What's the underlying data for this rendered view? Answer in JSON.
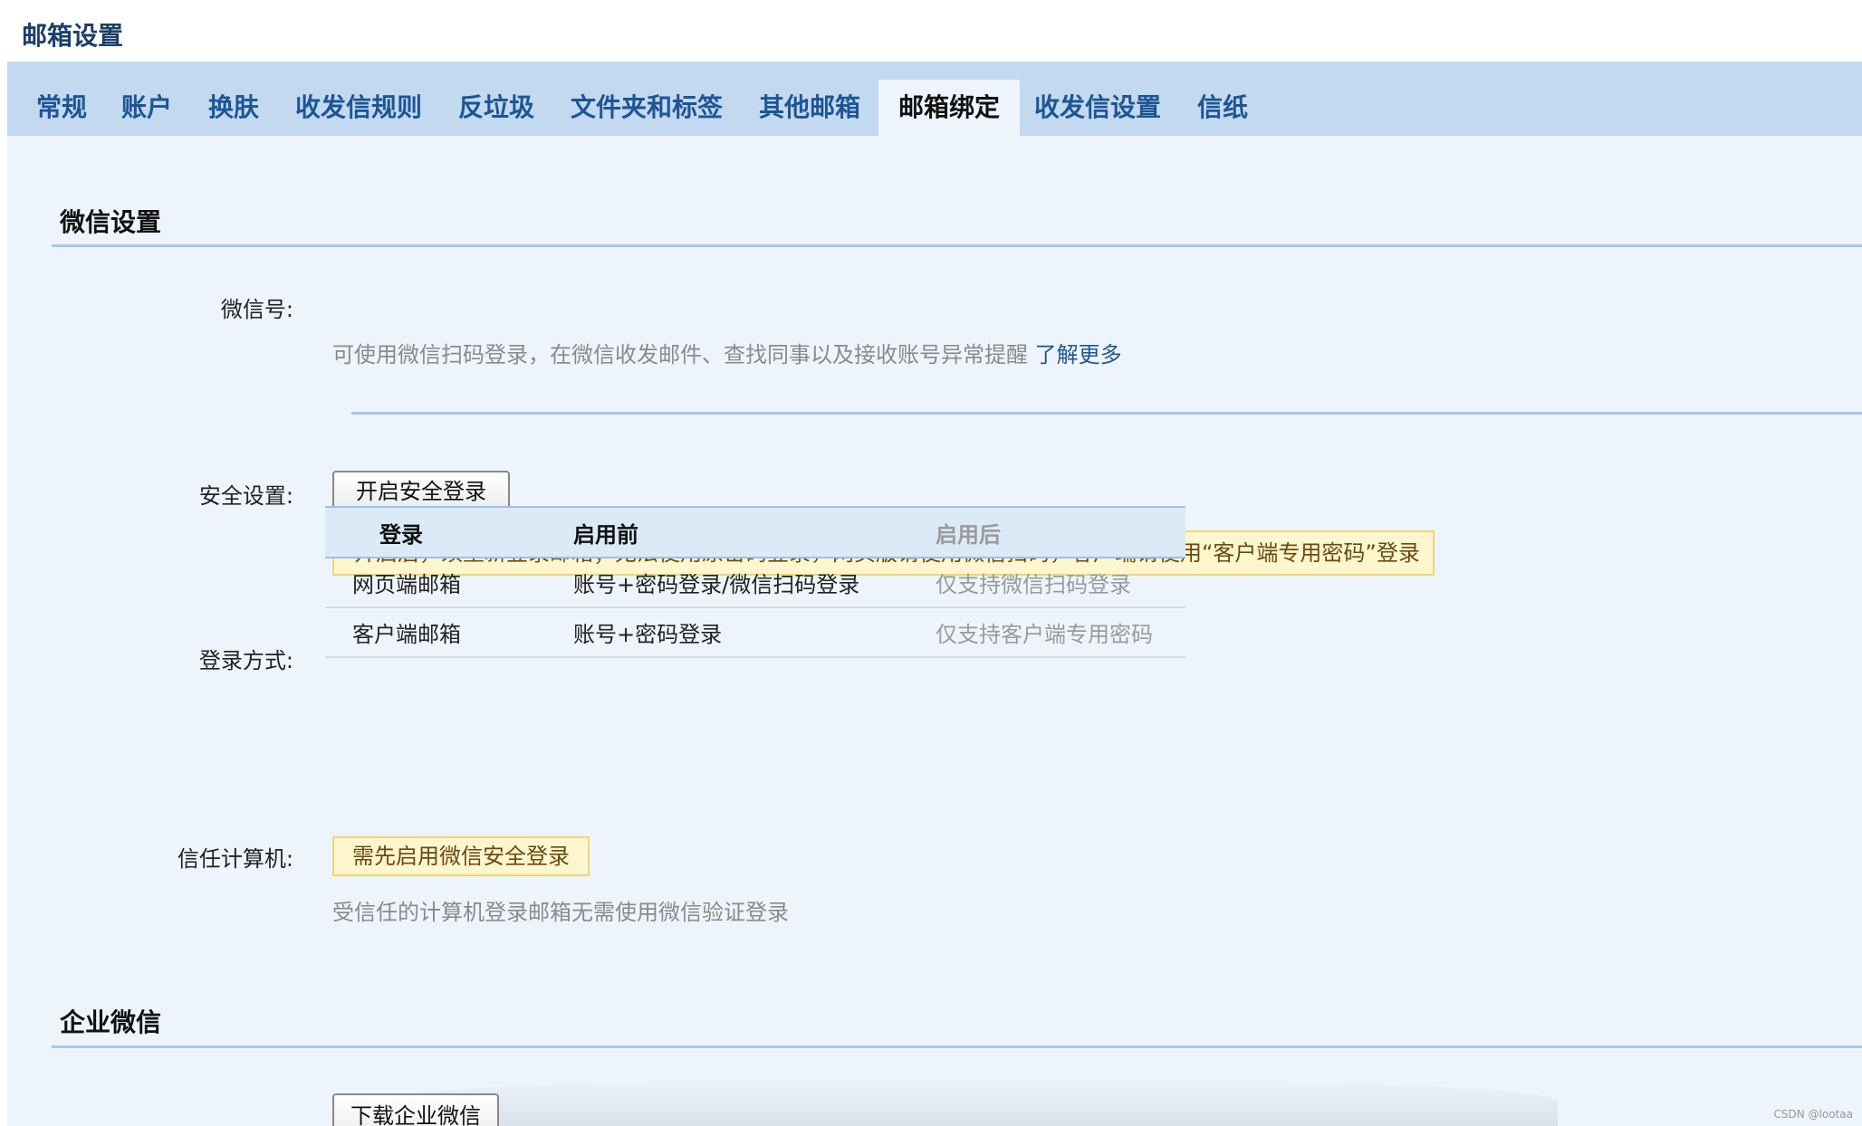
{
  "page": {
    "title": "邮箱设置"
  },
  "tabs": [
    {
      "label": "常规"
    },
    {
      "label": "账户"
    },
    {
      "label": "换肤"
    },
    {
      "label": "收发信规则"
    },
    {
      "label": "反垃圾"
    },
    {
      "label": "文件夹和标签"
    },
    {
      "label": "其他邮箱"
    },
    {
      "label": "邮箱绑定",
      "active": true
    },
    {
      "label": "收发信设置"
    },
    {
      "label": "信纸"
    }
  ],
  "wechat": {
    "section_title": "微信设置",
    "account_label": "微信号:",
    "account_desc": "可使用微信扫码登录，在微信收发邮件、查找同事以及接收账号异常提醒",
    "learn_more": "了解更多",
    "security_label": "安全设置:",
    "security_button": "开启安全登录",
    "security_notice": "开启后，须重新登录邮箱；无法使用原密码登录，网页版请使用微信扫码，客户端请使用“客户端专用密码”登录",
    "login_label": "登录方式:",
    "table": {
      "headers": [
        "登录",
        "启用前",
        "启用后"
      ],
      "rows": [
        [
          "网页端邮箱",
          "账号+密码登录/微信扫码登录",
          "仅支持微信扫码登录"
        ],
        [
          "客户端邮箱",
          "账号+密码登录",
          "仅支持客户端专用密码"
        ]
      ]
    },
    "trusted_label": "信任计算机:",
    "trusted_notice": "需先启用微信安全登录",
    "trusted_desc": "受信任的计算机登录邮箱无需使用微信验证登录"
  },
  "wework": {
    "section_title": "企业微信",
    "download_button": "下载企业微信"
  },
  "watermark": "CSDN @lootaa"
}
